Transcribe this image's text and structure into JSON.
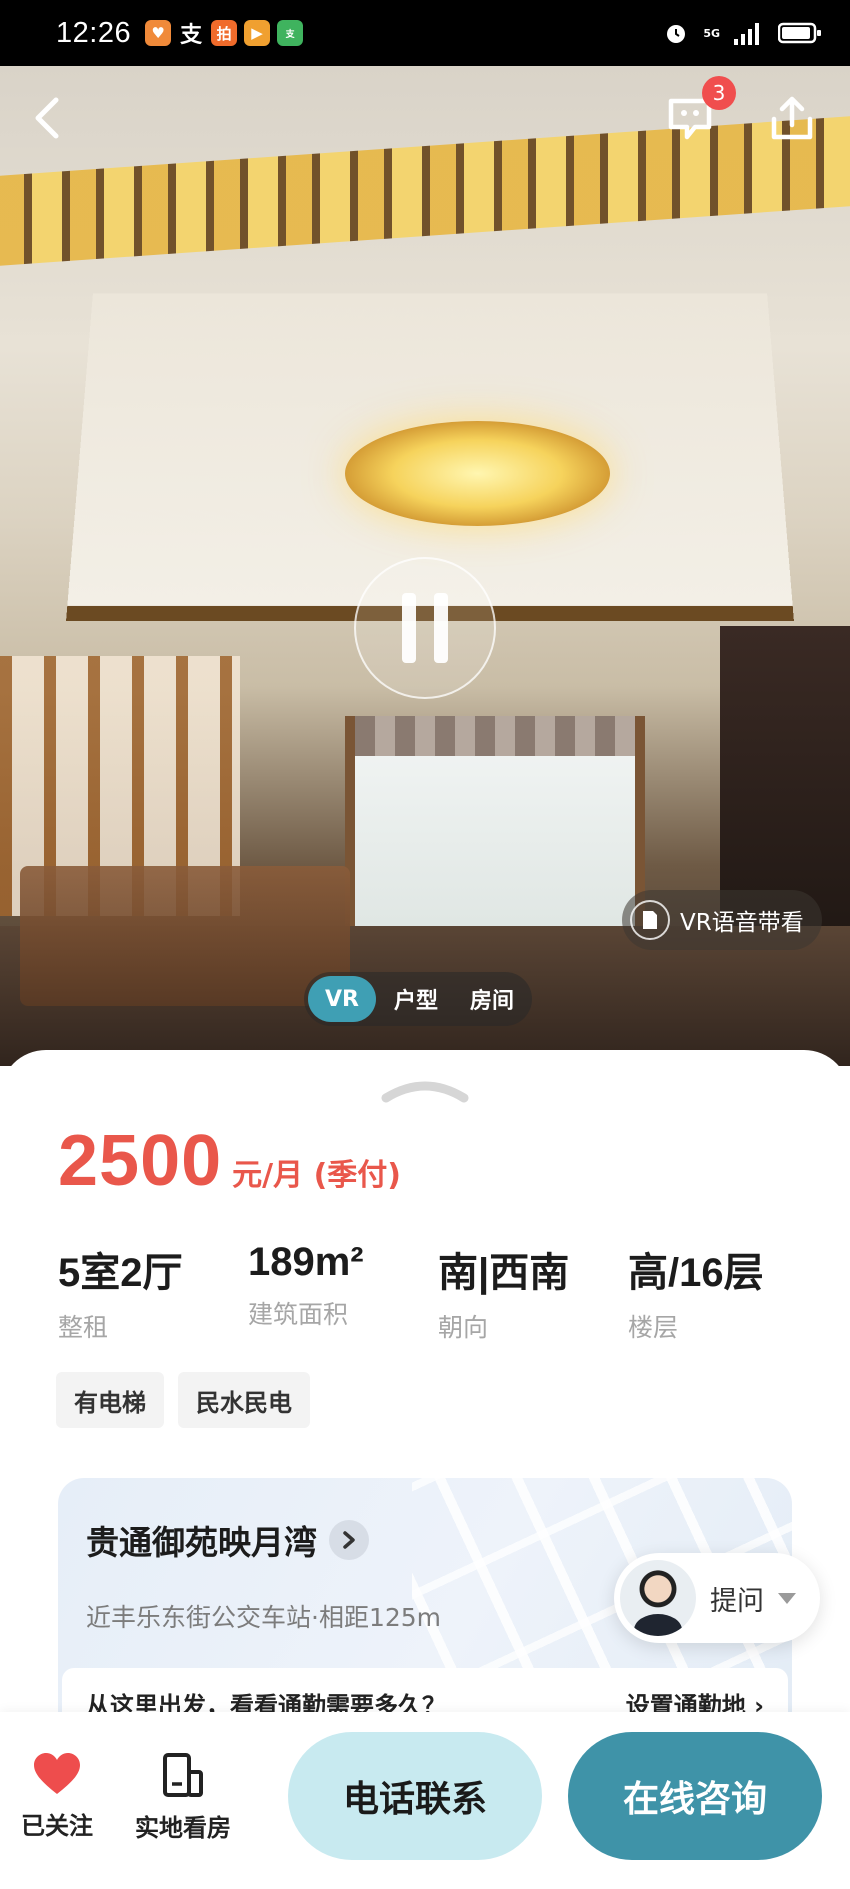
{
  "status_bar": {
    "time": "12:26",
    "network": "5G"
  },
  "header": {
    "message_badge": "3"
  },
  "hero": {
    "vr_guide_label": "VR语音带看",
    "tabs": [
      {
        "label": "VR",
        "active": true
      },
      {
        "label": "户型",
        "active": false
      },
      {
        "label": "房间",
        "active": false
      }
    ]
  },
  "listing": {
    "price": "2500",
    "price_unit": "元/月 (季付)",
    "stats": [
      {
        "value": "5室2厅",
        "label": "整租"
      },
      {
        "value": "189m²",
        "label": "建筑面积"
      },
      {
        "value": "南|西南",
        "label": "朝向"
      },
      {
        "value": "高/16层",
        "label": "楼层"
      }
    ],
    "tags": [
      "有电梯",
      "民水民电"
    ],
    "community": {
      "name": "贵通御苑映月湾",
      "transit": "近丰乐东街公交车站·相距125m",
      "commute_prompt": "从这里出发，看看通勤需要多久？",
      "commute_action": "设置通勤地 ›"
    }
  },
  "agent": {
    "ask_label": "提问"
  },
  "bottom_bar": {
    "follow_label": "已关注",
    "visit_label": "实地看房",
    "call_label": "电话联系",
    "chat_label": "在线咨询"
  },
  "colors": {
    "price": "#e9574b",
    "accent": "#3f93a8",
    "call_button": "#c8eaf0",
    "heart": "#ee4d4d"
  }
}
